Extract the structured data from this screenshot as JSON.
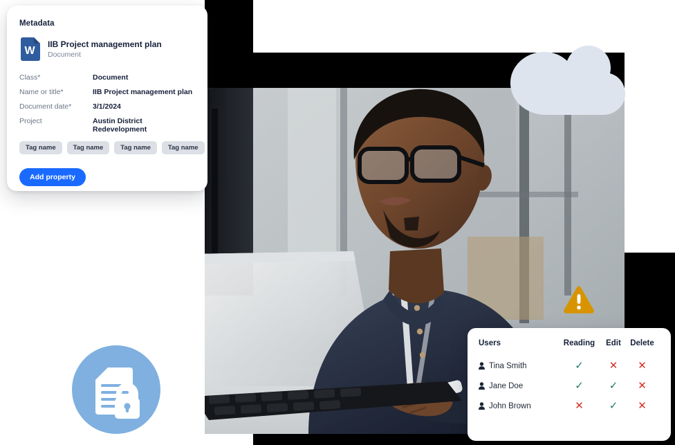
{
  "metadata_card": {
    "title": "Metadata",
    "document": {
      "icon": "word-document-icon",
      "name": "IIB Project management plan",
      "type": "Document"
    },
    "properties": [
      {
        "label": "Class*",
        "value": "Document"
      },
      {
        "label": "Name or title*",
        "value": "IIB Project management plan"
      },
      {
        "label": "Document date*",
        "value": "3/1/2024"
      },
      {
        "label": "Project",
        "value": "Austin District Redevelopment"
      }
    ],
    "tags": [
      "Tag name",
      "Tag name",
      "Tag name",
      "Tag name"
    ],
    "add_property_label": "Add property"
  },
  "permissions_card": {
    "columns": [
      "Users",
      "Reading",
      "Edit",
      "Delete"
    ],
    "rows": [
      {
        "user": "Tina Smith",
        "reading": "✓",
        "edit": "✕",
        "delete": "✕"
      },
      {
        "user": "Jane Doe",
        "reading": "✓",
        "edit": "✓",
        "delete": "✕"
      },
      {
        "user": "John Brown",
        "reading": "✕",
        "edit": "✓",
        "delete": "✕"
      }
    ]
  },
  "decorations": {
    "warning_icon": "warning-triangle-icon",
    "secure_document_icon": "document-lock-icon",
    "cloud_icon": "cloud-shape-icon",
    "photo": "man-working-at-desktop-computer-photo"
  },
  "colors": {
    "accent_blue": "#1a6aff",
    "word_blue": "#2f5c9e",
    "tag_grey": "#dcdfe5",
    "label_grey": "#6b7687",
    "text_navy": "#16203a",
    "check_green": "#1f7a6b",
    "cross_red": "#d93025",
    "warning_amber": "#d79400",
    "cloud_blue": "#dde4ee",
    "icon_circle_blue": "#7fb0e0",
    "backing_black": "#000000"
  }
}
